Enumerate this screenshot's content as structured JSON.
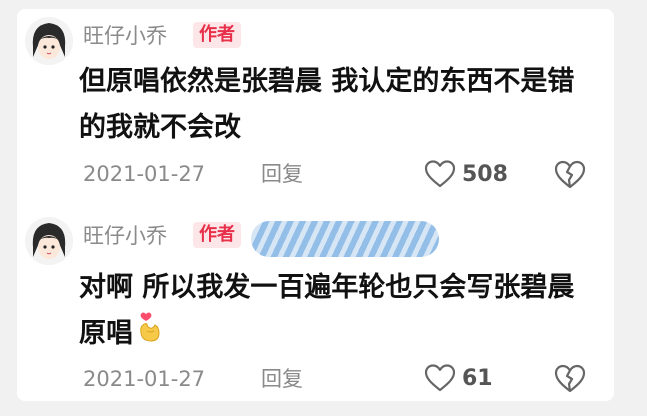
{
  "comments": [
    {
      "username": "旺仔小乔",
      "badge": "作者",
      "text": "但原唱依然是张碧晨 我认定的东西不是错的我就不会改",
      "date": "2021-01-27",
      "reply_label": "回复",
      "likes": "508"
    },
    {
      "username": "旺仔小乔",
      "badge": "作者",
      "text": "对啊 所以我发一百遍年轮也只会写张碧晨原唱",
      "date": "2021-01-27",
      "reply_label": "回复",
      "likes": "61"
    }
  ],
  "icons": {
    "like": "heart-outline-icon",
    "dislike": "broken-heart-icon",
    "emoji": "heart-hands-emoji-icon"
  },
  "colors": {
    "badge_text": "#e8304b",
    "badge_bg": "#fde6e8",
    "meta_text": "#8a8a8a"
  }
}
